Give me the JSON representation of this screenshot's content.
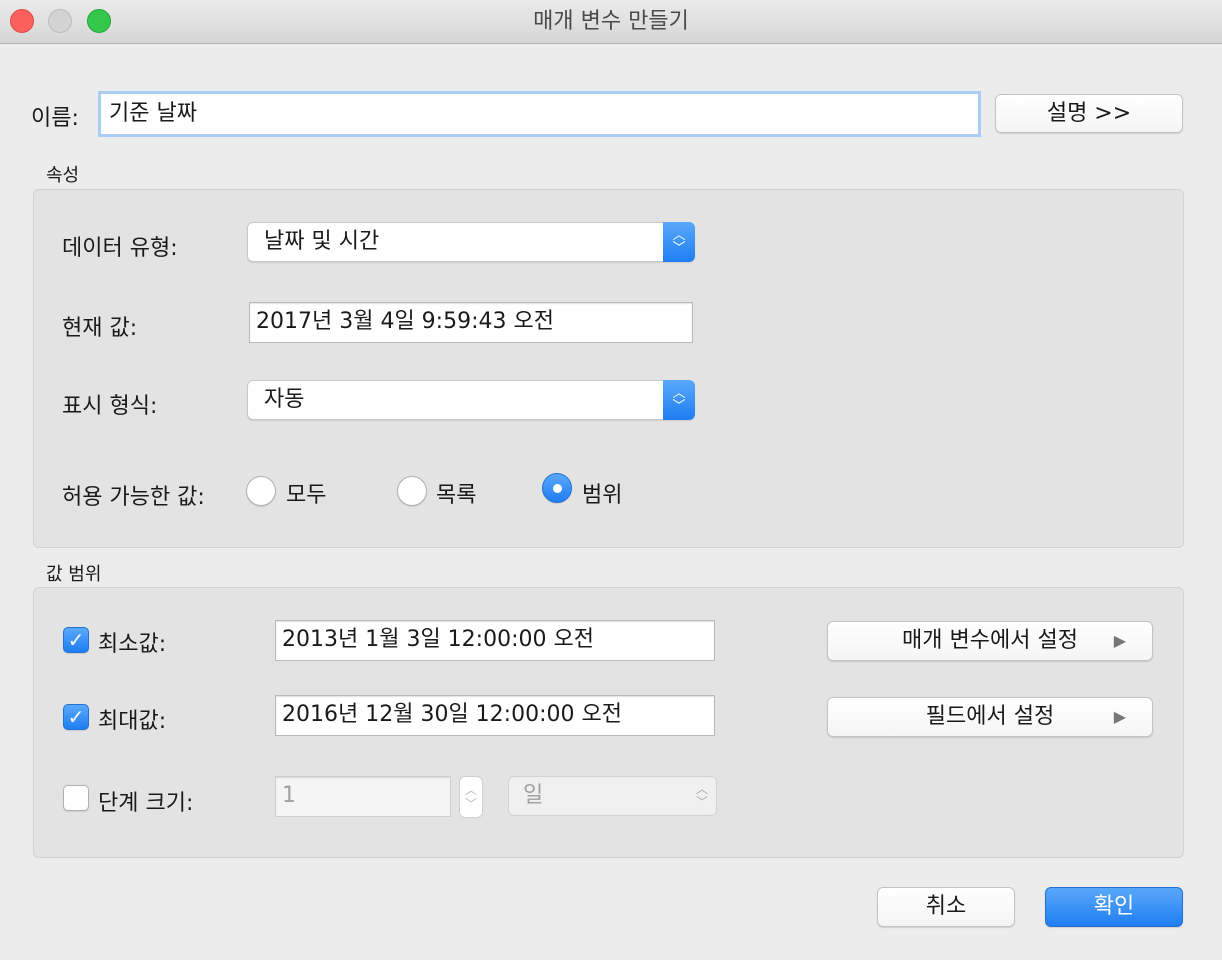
{
  "window": {
    "title": "매개 변수 만들기"
  },
  "name": {
    "label": "이름:",
    "value": "기준 날짜",
    "comment_button": "설명 >>"
  },
  "properties": {
    "section_title": "속성",
    "data_type": {
      "label": "데이터 유형:",
      "value": "날짜 및 시간"
    },
    "current_value": {
      "label": "현재 값:",
      "value": "2017년 3월 4일 9:59:43 오전"
    },
    "display_format": {
      "label": "표시 형식:",
      "value": "자동"
    },
    "allowable_values": {
      "label": "허용 가능한 값:",
      "options": [
        "모두",
        "목록",
        "범위"
      ],
      "selected": "범위"
    }
  },
  "range": {
    "section_title": "값 범위",
    "min": {
      "label": "최소값:",
      "checked": true,
      "value": "2013년 1월 3일 12:00:00 오전"
    },
    "max": {
      "label": "최대값:",
      "checked": true,
      "value": "2016년 12월 30일 12:00:00 오전"
    },
    "step": {
      "label": "단계 크기:",
      "checked": false,
      "value": "1",
      "unit": "일"
    },
    "set_from_parameter": "매개 변수에서 설정",
    "set_from_field": "필드에서 설정"
  },
  "footer": {
    "cancel": "취소",
    "ok": "확인"
  },
  "colors": {
    "accent": "#1f7ef2",
    "close": "#fc605c",
    "maximize": "#34c84a"
  },
  "icons": {
    "popup_arrows": "chevron-up-down-icon",
    "menu_arrow": "triangle-right-icon",
    "check": "checkmark-icon"
  }
}
